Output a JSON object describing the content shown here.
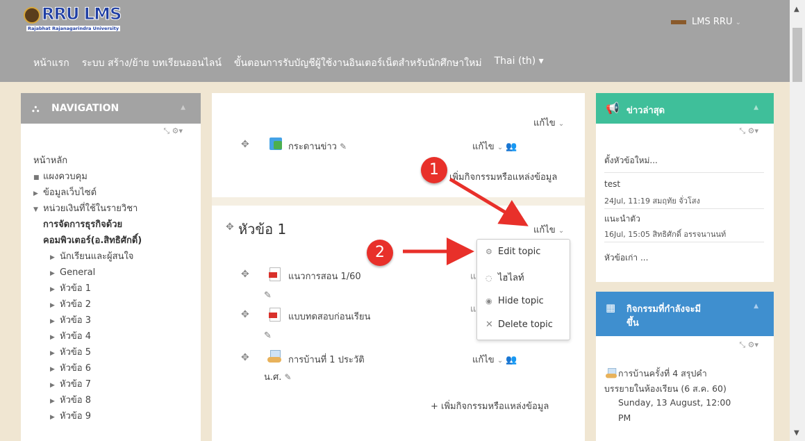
{
  "header": {
    "logo_text": "RRU LMS",
    "logo_subtext": "Rajabhat Rajanagarindra University",
    "user_label": "LMS RRU",
    "nav": [
      "หน้าแรก",
      "ระบบ สร้าง/ย้าย บทเรียนออนไลน์",
      "ขั้นตอนการรับบัญชีผู้ใช้งานอินเตอร์เน็ตสำหรับนักศึกษาใหม่",
      "Thai (th) ▾"
    ]
  },
  "navigation": {
    "title": "NAVIGATION",
    "items": [
      "หน้าหลัก",
      "แผงควบคุม",
      "ข้อมูลเว็บไซต์",
      "หน่วยเงินที่ใช้ในรายวิชา",
      "การจัดการธุรกิจด้วย",
      "คอมพิวเตอร์(อ.สิทธิศักดิ์)",
      "นักเรียนและผู้สนใจ",
      "General",
      "หัวข้อ 1",
      "หัวข้อ 2",
      "หัวข้อ 3",
      "หัวข้อ 4",
      "หัวข้อ 5",
      "หัวข้อ 6",
      "หัวข้อ 7",
      "หัวข้อ 8",
      "หัวข้อ 9"
    ]
  },
  "main": {
    "edit_label": "แก้ไข",
    "forum_name": "กระดานข่าว",
    "add_activity": "เพิ่มกิจกรรมหรือแหล่งข้อมูล",
    "topic_title": "หัวข้อ 1",
    "res1": "แนวการสอน 1/60",
    "res2": "แบบทดสอบก่อนเรียน",
    "assign1_line1": "การบ้านที่ 1 ประวัติ",
    "assign1_line2": "น.ศ.",
    "add_activity2": "+ เพิ่มกิจกรรมหรือแหล่งข้อมูล"
  },
  "dropdown": {
    "items": [
      {
        "icon": "gear-icon",
        "label": "Edit topic"
      },
      {
        "icon": "lightbulb-icon",
        "label": "ไฮไลท์"
      },
      {
        "icon": "eye-icon",
        "label": "Hide topic"
      },
      {
        "icon": "close-icon",
        "label": "Delete topic"
      }
    ]
  },
  "annotations": {
    "badge1": "1",
    "badge2": "2"
  },
  "news": {
    "title": "ข่าวล่าสุด",
    "add_topic": "ตั้งหัวข้อใหม่...",
    "post1_title": "test",
    "post1_meta": "24Jul, 11:19 สมฤทัย จั่วโสง",
    "post2_title": "แนะนำตัว",
    "post2_meta": "16Jul, 15:05 สิทธิศักดิ์ อรรจนานนท์",
    "older": "หัวข้อเก่า ..."
  },
  "events": {
    "title_line1": "กิจกรรมที่กำลังจะมี",
    "title_line2": "ขึ้น",
    "event_line1": "การบ้านครั้งที่ 4 สรุปคำ",
    "event_line2": "บรรยายในห้องเรียน (6 ส.ค. 60)",
    "event_date": "Sunday, 13 August, 12:00",
    "event_time": "PM"
  }
}
